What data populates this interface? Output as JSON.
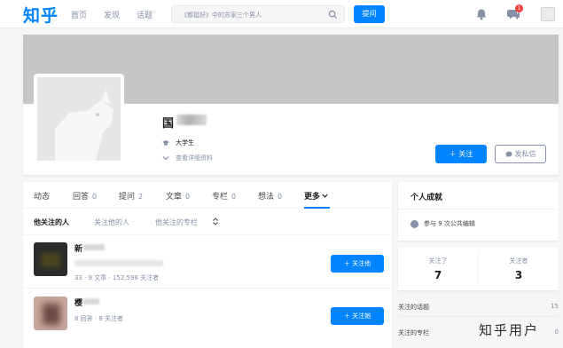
{
  "topbar": {
    "logo": "知乎",
    "nav": [
      "首页",
      "发现",
      "话题"
    ],
    "search_placeholder": "《都挺好》中的苏家三个男人",
    "ask_label": "提问",
    "notification_badge": "1"
  },
  "profile": {
    "name": "国",
    "info_education": "大学生",
    "info_more": "查看详细资料",
    "follow_label": "关注",
    "message_label": "发私信"
  },
  "tabs": [
    {
      "label": "动态",
      "count": ""
    },
    {
      "label": "回答",
      "count": "0"
    },
    {
      "label": "提问",
      "count": "2"
    },
    {
      "label": "文章",
      "count": "0"
    },
    {
      "label": "专栏",
      "count": "0"
    },
    {
      "label": "想法",
      "count": "0"
    },
    {
      "label": "更多",
      "count": ""
    }
  ],
  "subtabs": [
    "他关注的人",
    "关注他的人",
    "他关注的专栏"
  ],
  "people": [
    {
      "name": "新",
      "stats": "33 · 9 文章 · 152,598 关注者",
      "button": "关注他"
    },
    {
      "name": "樱",
      "stats": "8 回答 · 8 关注者",
      "button": "关注她"
    }
  ],
  "side": {
    "title": "个人成就",
    "edit_text": "参与 9 次公共编辑",
    "following_label": "关注了",
    "following_value": "7",
    "followers_label": "关注者",
    "followers_value": "3",
    "topics_label": "关注的话题",
    "topics_value": "15",
    "columns_label": "关注的专栏",
    "columns_value": "0"
  },
  "watermark": "知乎用户",
  "colors": {
    "brand": "#0084ff",
    "muted": "#8590a6"
  }
}
